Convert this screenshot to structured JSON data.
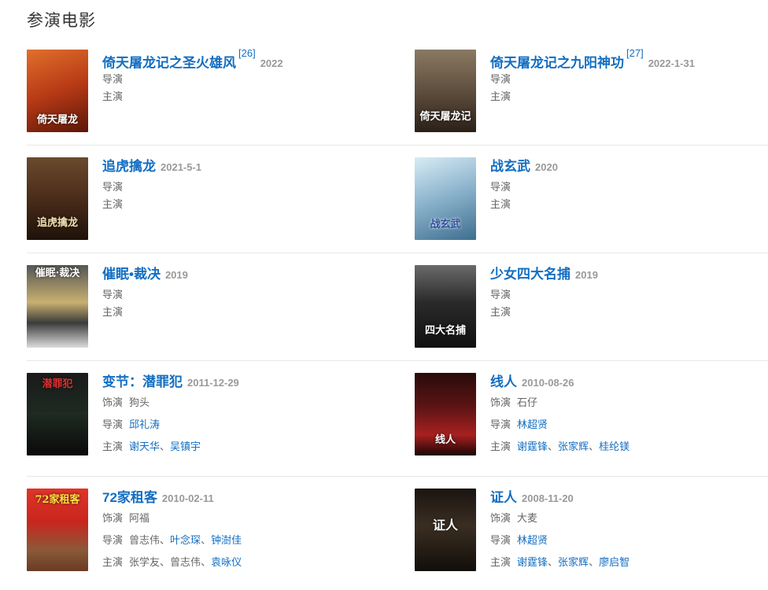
{
  "section": {
    "title": "参演电影"
  },
  "films": [
    {
      "title": "倚天屠龙记之圣火雄风",
      "ref": "[26]",
      "date": "2022",
      "director_label": "导演",
      "actor_label": "主演",
      "poster_text": "倚天屠龙",
      "poster_bg": "#b83a16"
    },
    {
      "title": "倚天屠龙记之九阳神功",
      "ref": "[27]",
      "date": "2022-1-31",
      "director_label": "导演",
      "actor_label": "主演",
      "poster_text": "倚天屠龙记",
      "poster_bg": "#5a4a3a"
    },
    {
      "title": "追虎擒龙",
      "date": "2021-5-1",
      "director_label": "导演",
      "actor_label": "主演",
      "poster_text": "追虎擒龙",
      "poster_bg": "#4a2c1a"
    },
    {
      "title": "战玄武",
      "date": "2020",
      "director_label": "导演",
      "actor_label": "主演",
      "poster_text": "战玄武",
      "poster_bg": "#8fb6cf"
    },
    {
      "title": "催眠•裁决",
      "date": "2019",
      "director_label": "导演",
      "actor_label": "主演",
      "poster_text": "催眠·裁决",
      "poster_bg": "#3b3b3b"
    },
    {
      "title": "少女四大名捕",
      "date": "2019",
      "director_label": "导演",
      "actor_label": "主演",
      "poster_text": "四大名捕",
      "poster_bg": "#2a2a2a"
    },
    {
      "title": "变节：潜罪犯",
      "date": "2011-12-29",
      "role_label": "饰演",
      "role": "狗头",
      "director_label": "导演",
      "directors": [
        "邱礼涛"
      ],
      "actor_label": "主演",
      "actors": [
        "谢天华",
        "吴镇宇"
      ],
      "poster_text": "潜罪犯",
      "poster_bg": "#1e2a22"
    },
    {
      "title": "线人",
      "date": "2010-08-26",
      "role_label": "饰演",
      "role": "石仔",
      "director_label": "导演",
      "directors": [
        "林超贤"
      ],
      "actor_label": "主演",
      "actors": [
        "谢霆锋",
        "张家辉",
        "桂纶镁"
      ],
      "poster_text": "线人",
      "poster_bg": "#5a1414"
    },
    {
      "title": "72家租客",
      "date": "2010-02-11",
      "role_label": "饰演",
      "role": "阿福",
      "director_label": "导演",
      "directors_plain": [
        "曾志伟"
      ],
      "directors": [
        "叶念琛",
        "钟澍佳"
      ],
      "actor_label": "主演",
      "actors_plain": [
        "张学友",
        "曾志伟"
      ],
      "actors": [
        "袁咏仪"
      ],
      "poster_text": "72家租客",
      "poster_bg": "#c8261e"
    },
    {
      "title": "证人",
      "date": "2008-11-20",
      "role_label": "饰演",
      "role": "大麦",
      "director_label": "导演",
      "directors": [
        "林超贤"
      ],
      "actor_label": "主演",
      "actors": [
        "谢霆锋",
        "张家辉",
        "廖启智"
      ],
      "poster_text": "证人",
      "poster_bg": "#3a2e22"
    }
  ],
  "separator": "、"
}
